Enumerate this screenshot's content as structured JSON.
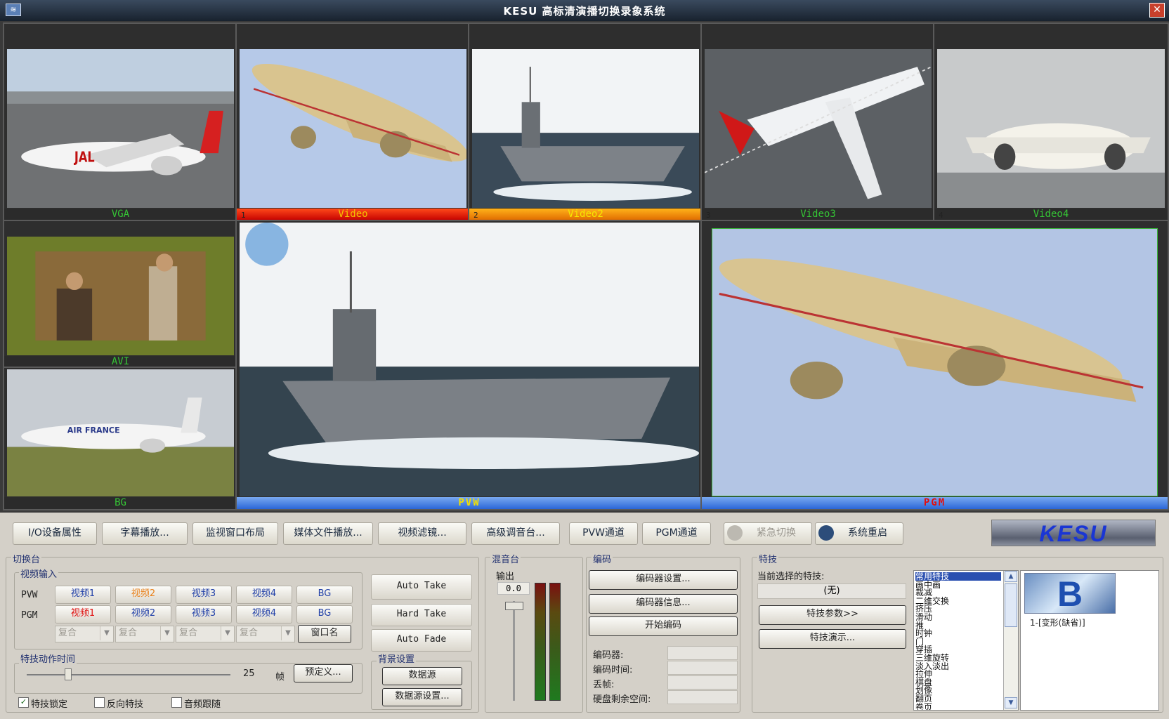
{
  "window": {
    "title": "KESU 高标清演播切换录象系统",
    "close": "✕"
  },
  "monitors": {
    "vga": {
      "label": "VGA"
    },
    "video1": {
      "label": "Video",
      "num": "1"
    },
    "video2": {
      "label": "Video2",
      "num": "2"
    },
    "video3": {
      "label": "Video3",
      "num": "3"
    },
    "video4": {
      "label": "Video4",
      "num": "4"
    },
    "avi": {
      "label": "AVI"
    },
    "bg": {
      "label": "BG"
    },
    "pvw": {
      "label": "PVW"
    },
    "pgm": {
      "label": "PGM"
    }
  },
  "toolbar": {
    "io": "I/O设备属性",
    "subtitle": "字幕播放...",
    "layout": "监视窗口布局",
    "media": "媒体文件播放...",
    "filter": "视频滤镜...",
    "mixer": "高级调音台...",
    "pvw_channel": "PVW通道",
    "pgm_channel": "PGM通道",
    "emergency": "紧急切换",
    "restart": "系统重启",
    "logo": "KESU"
  },
  "switcher": {
    "group": "切换台",
    "input_group": "视频输入",
    "pvw_label": "PVW",
    "pgm_label": "PGM",
    "pvw": [
      "视频1",
      "视频2",
      "视频3",
      "视频4",
      "BG"
    ],
    "pgm": [
      "视频1",
      "视频2",
      "视频3",
      "视频4",
      "BG"
    ],
    "combo": [
      "复合",
      "复合",
      "复合",
      "复合"
    ],
    "window_name": "窗口名",
    "auto_take": "Auto Take",
    "hard_take": "Hard Take",
    "auto_fade": "Auto Fade",
    "time_group": "特技动作时间",
    "time_value": "25",
    "time_unit": "帧",
    "preset": "预定义...",
    "bg_group": "背景设置",
    "datasource": "数据源",
    "datasource_setup": "数据源设置...",
    "lock": "特技锁定",
    "reverse": "反向特技",
    "audio_follow": "音频跟随"
  },
  "mixer": {
    "group": "混音台",
    "output": "输出",
    "value": "0.0"
  },
  "encoder": {
    "group": "编码",
    "settings": "编码器设置...",
    "info": "编码器信息...",
    "start": "开始编码",
    "encoder_label": "编码器:",
    "time_label": "编码时间:",
    "drop_label": "丢帧:",
    "disk_label": "硬盘剩余空间:"
  },
  "effects": {
    "group": "特技",
    "current_label": "当前选择的特技:",
    "current_value": "(无)",
    "params": "特技参数>>",
    "demo": "特技演示...",
    "list": [
      "常用特技",
      "画中画",
      "裁减",
      "二维交换",
      "挤压",
      "滑动",
      "推",
      "时钟",
      "门",
      "穿插",
      "三维旋转",
      "淡入淡出",
      "拉伸",
      "棋盘",
      "划像",
      "翻页",
      "卷页"
    ],
    "preview_caption": "1-[变形(缺省)]",
    "preview_letter": "B"
  }
}
